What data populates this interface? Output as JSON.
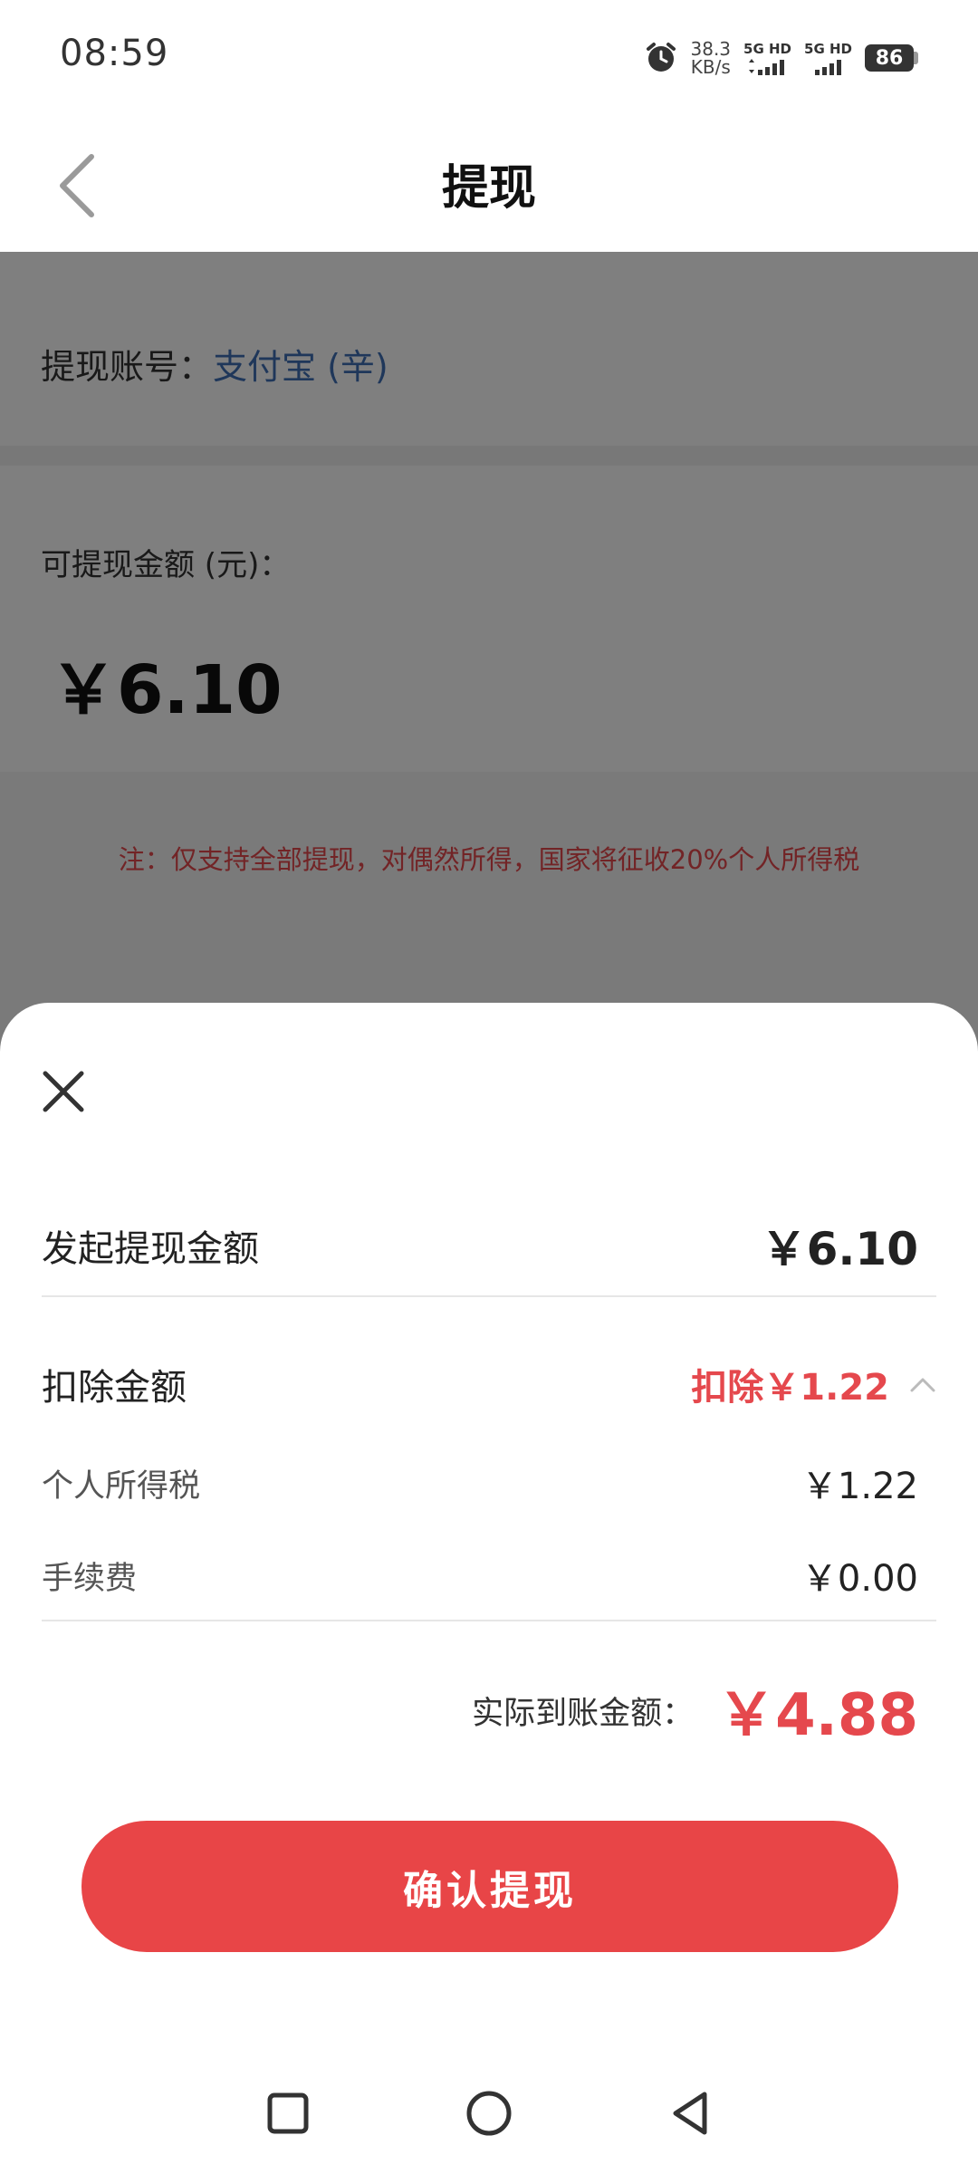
{
  "status_bar": {
    "time": "08:59",
    "net_speed_value": "38.3",
    "net_speed_unit": "KB/s",
    "sim1_label": "5G HD",
    "sim2_label": "5G HD",
    "battery": "86",
    "icons": [
      "alarm-icon",
      "signal-icon",
      "battery-icon"
    ]
  },
  "header": {
    "title": "提现",
    "back_icon": "chevron-left-icon"
  },
  "account": {
    "label": "提现账号：",
    "value": "支付宝 (辛)"
  },
  "balance": {
    "label": "可提现金额 (元)：",
    "amount": "￥6.10"
  },
  "note": "注：仅支持全部提现，对偶然所得，国家将征收20%个人所得税",
  "sheet": {
    "close_icon": "close-icon",
    "initiate_label": "发起提现金额",
    "initiate_value": "￥6.10",
    "deduct_label": "扣除金额",
    "deduct_value": "扣除￥1.22",
    "tax_label": "个人所得税",
    "tax_value": "￥1.22",
    "fee_label": "手续费",
    "fee_value": "￥0.00",
    "actual_label": "实际到账金额：",
    "actual_value": "￥4.88",
    "confirm_label": "确认提现"
  },
  "colors": {
    "accent_red": "#e84547",
    "link_blue": "#3e6fb5"
  }
}
